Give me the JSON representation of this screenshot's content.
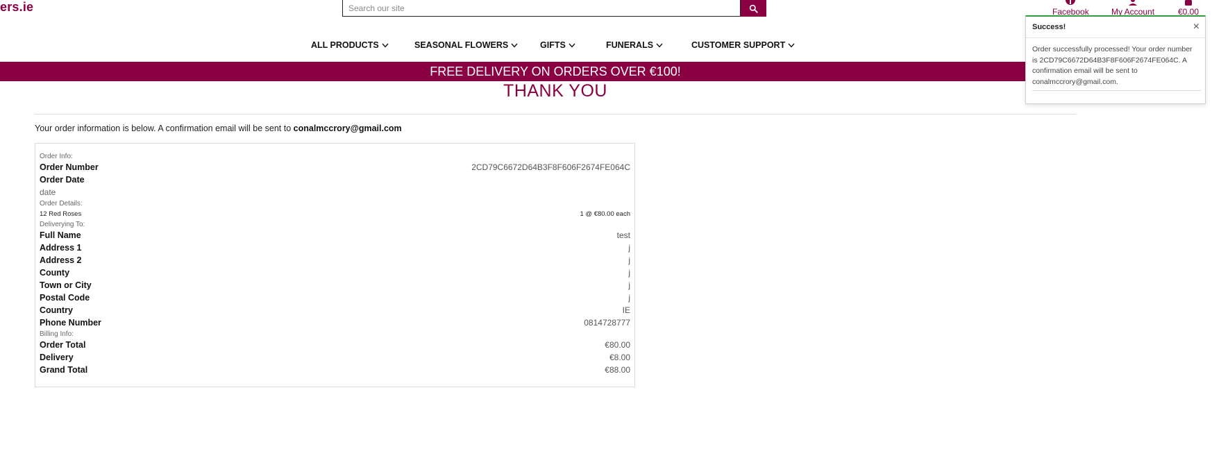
{
  "brand": {
    "logo_text": "ers.ie",
    "color": "#8b0042"
  },
  "search": {
    "placeholder": "Search our site",
    "icon": "search-icon"
  },
  "top_links": {
    "facebook": {
      "label": "Facebook",
      "icon": "facebook-icon"
    },
    "account": {
      "label": "My Account",
      "icon": "user-icon"
    },
    "bag": {
      "label": "€0.00",
      "icon": "shopping-bag-icon"
    }
  },
  "nav": {
    "items": [
      {
        "label": "ALL PRODUCTS"
      },
      {
        "label": "SEASONAL FLOWERS"
      },
      {
        "label": "GIFTS"
      },
      {
        "label": "FUNERALS"
      },
      {
        "label": "CUSTOMER SUPPORT"
      }
    ]
  },
  "banner": {
    "text": "FREE DELIVERY ON ORDERS OVER €100!"
  },
  "page": {
    "title": "THANK YOU",
    "intro": "Your order information is below. A confirmation email will be sent to",
    "email": "conalmccrory@gmail.com"
  },
  "order": {
    "info_heading": "Order Info:",
    "number_label": "Order Number",
    "number_value": "2CD79C6672D64B3F8F606F2674FE064C",
    "date_label": "Order Date",
    "date_value": "date",
    "details_heading": "Order Details:",
    "items": [
      {
        "name": "12 Red Roses",
        "qty_price": "1 @ €80.00 each"
      }
    ],
    "delivery_heading": "Deliverying To:",
    "delivery": [
      {
        "label": "Full Name",
        "value": "test"
      },
      {
        "label": "Address 1",
        "value": "j"
      },
      {
        "label": "Address 2",
        "value": "j"
      },
      {
        "label": "County",
        "value": "j"
      },
      {
        "label": "Town or City",
        "value": "j"
      },
      {
        "label": "Postal Code",
        "value": "j"
      },
      {
        "label": "Country",
        "value": "IE"
      },
      {
        "label": "Phone Number",
        "value": "0814728777"
      }
    ],
    "billing_heading": "Billing Info:",
    "billing": [
      {
        "label": "Order Total",
        "value": "€80.00"
      },
      {
        "label": "Delivery",
        "value": "€8.00"
      },
      {
        "label": "Grand Total",
        "value": "€88.00"
      }
    ]
  },
  "toast": {
    "title": "Success!",
    "close": "×",
    "message": "Order successfully processed! Your order number is 2CD79C6672D64B3F8F606F2674FE064C. A confirmation email will be sent to conalmccrory@gmail.com.",
    "accent": "#2e9e3e"
  }
}
